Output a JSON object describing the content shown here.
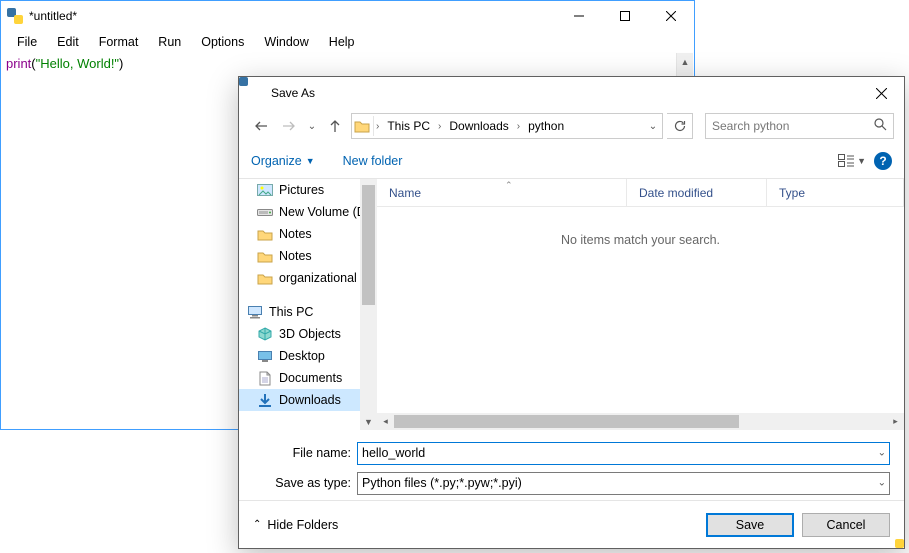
{
  "idle": {
    "title": "*untitled*",
    "menus": [
      "File",
      "Edit",
      "Format",
      "Run",
      "Options",
      "Window",
      "Help"
    ],
    "code_fn": "print",
    "code_paren_open": "(",
    "code_str": "\"Hello, World!\"",
    "code_paren_close": ")"
  },
  "dlg": {
    "title": "Save As",
    "crumbs": [
      "This PC",
      "Downloads",
      "python"
    ],
    "search_placeholder": "Search python",
    "toolbar": {
      "organize": "Organize",
      "newfolder": "New folder"
    },
    "columns": {
      "name": "Name",
      "date": "Date modified",
      "type": "Type"
    },
    "empty_msg": "No items match your search.",
    "tree": [
      {
        "label": "Pictures",
        "icon": "picture",
        "pinned": true
      },
      {
        "label": "New Volume (D:",
        "icon": "drive"
      },
      {
        "label": "Notes",
        "icon": "folder"
      },
      {
        "label": "Notes",
        "icon": "folder"
      },
      {
        "label": "organizational d",
        "icon": "folder"
      },
      {
        "label": "",
        "icon": "spacer"
      },
      {
        "label": "This PC",
        "icon": "thispc",
        "thispc": true
      },
      {
        "label": "3D Objects",
        "icon": "3d"
      },
      {
        "label": "Desktop",
        "icon": "desktop"
      },
      {
        "label": "Documents",
        "icon": "documents"
      },
      {
        "label": "Downloads",
        "icon": "downloads",
        "selected": true
      }
    ],
    "filename_label": "File name:",
    "filetype_label": "Save as type:",
    "filename_value": "hello_world",
    "filetype_value": "Python files (*.py;*.pyw;*.pyi)",
    "hide_folders": "Hide Folders",
    "save_btn": "Save",
    "cancel_btn": "Cancel"
  }
}
